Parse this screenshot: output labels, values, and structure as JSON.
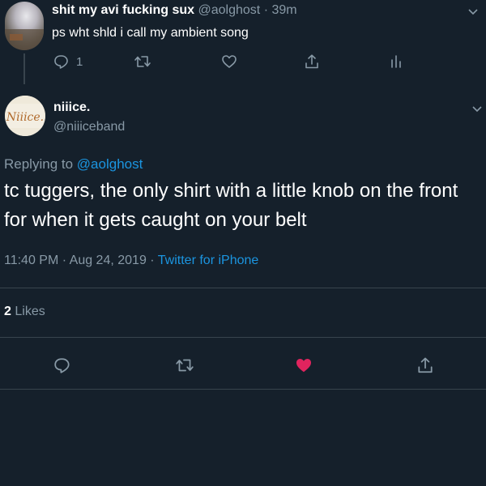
{
  "parent_tweet": {
    "display_name": "shit my avi fucking sux",
    "handle": "@aolghost",
    "separator": "·",
    "time": "39m",
    "text": "ps wht shld i call my ambient song",
    "reply_count": "1",
    "icons": [
      "reply-icon",
      "retweet-icon",
      "like-icon",
      "share-icon",
      "analytics-icon"
    ]
  },
  "main_tweet": {
    "display_name": "niiice.",
    "handle": "@niiiceband",
    "avatar_text": "Niiice.",
    "replying_prefix": "Replying to",
    "replying_to": "@aolghost",
    "text": "tc tuggers, the only shirt with a little knob on the front for when it gets caught on your belt",
    "time": "11:40 PM",
    "date": "Aug 24, 2019",
    "meta_separator": "·",
    "source": "Twitter for iPhone",
    "likes_count": "2",
    "likes_label": "Likes",
    "icons": [
      "reply-icon",
      "retweet-icon",
      "liked-heart-icon",
      "share-icon"
    ]
  },
  "colors": {
    "background": "#15202b",
    "text_primary": "#ffffff",
    "text_secondary": "#8899a6",
    "link": "#1b95e0",
    "liked": "#e0245e",
    "divider": "#38444d"
  }
}
